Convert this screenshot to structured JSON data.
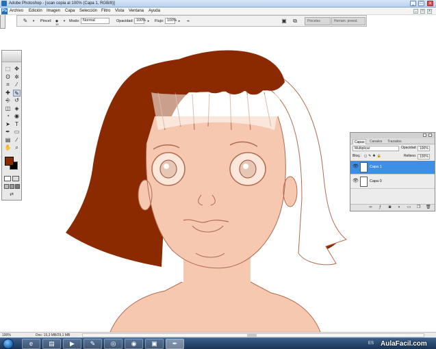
{
  "window": {
    "title": "Adobe Photoshop - [scan copia al 100% (Capa 1, RGB/8)]",
    "minimize_label": "_",
    "maximize_label": "□",
    "close_label": "x"
  },
  "menu": {
    "items": [
      "Archivo",
      "Edición",
      "Imagen",
      "Capa",
      "Selección",
      "Filtro",
      "Vista",
      "Ventana",
      "Ayuda"
    ],
    "doc_minimize": "_",
    "doc_restore": "□",
    "doc_close": "x"
  },
  "options_bar": {
    "brush_label": "Pincel:",
    "brush_size": "13",
    "mode_label": "Modo:",
    "mode_value": "Normal",
    "opacity_label": "Opacidad:",
    "opacity_value": "100%",
    "flow_label": "Flujo:",
    "flow_value": "100%",
    "tab_brushes": "Pinceles",
    "tab_tool_presets": "Herram. preest."
  },
  "tools_panel": {
    "tools": [
      {
        "name": "marquee-tool",
        "glyph": "⬚"
      },
      {
        "name": "move-tool",
        "glyph": "✥"
      },
      {
        "name": "lasso-tool",
        "glyph": "ʘ"
      },
      {
        "name": "magic-wand-tool",
        "glyph": "✲"
      },
      {
        "name": "crop-tool",
        "glyph": "⌗"
      },
      {
        "name": "slice-tool",
        "glyph": "⁄"
      },
      {
        "name": "healing-tool",
        "glyph": "✚"
      },
      {
        "name": "brush-tool",
        "glyph": "✎"
      },
      {
        "name": "stamp-tool",
        "glyph": "⎆"
      },
      {
        "name": "history-brush-tool",
        "glyph": "↺"
      },
      {
        "name": "eraser-tool",
        "glyph": "◫"
      },
      {
        "name": "bucket-tool",
        "glyph": "◈"
      },
      {
        "name": "blur-tool",
        "glyph": "◔"
      },
      {
        "name": "dodge-tool",
        "glyph": "◉"
      },
      {
        "name": "path-select-tool",
        "glyph": "➤"
      },
      {
        "name": "type-tool",
        "glyph": "T"
      },
      {
        "name": "pen-tool",
        "glyph": "✒"
      },
      {
        "name": "shape-tool",
        "glyph": "▭"
      },
      {
        "name": "notes-tool",
        "glyph": "▤"
      },
      {
        "name": "eyedropper-tool",
        "glyph": "⁄"
      },
      {
        "name": "hand-tool",
        "glyph": "✋"
      },
      {
        "name": "zoom-tool",
        "glyph": "⌕"
      }
    ],
    "foreground_color": "#8b2a00",
    "background_color": "#000000"
  },
  "layers_panel": {
    "tabs": [
      "Capas",
      "Canales",
      "Trazados"
    ],
    "blend_mode": "Multiplicar",
    "opacity_label": "Opacidad:",
    "opacity_value": "100%",
    "lock_label": "Bloq.:",
    "fill_label": "Relleno:",
    "fill_value": "100%",
    "layers": [
      {
        "name": "Capa 1",
        "selected": true
      },
      {
        "name": "Capa 0",
        "selected": false
      }
    ]
  },
  "status_bar": {
    "zoom": "100%",
    "doc_info": "Doc: 15,3 MB/29,1 MB"
  },
  "taskbar": {
    "tray_lang": "ES",
    "watermark": "AulaFacil.com"
  },
  "accent_colors": {
    "hair_paint": "#8b2a00",
    "skin": "#f6c8b0",
    "sketch_line": "#b06a50",
    "selection_blue": "#3d8fe6"
  }
}
